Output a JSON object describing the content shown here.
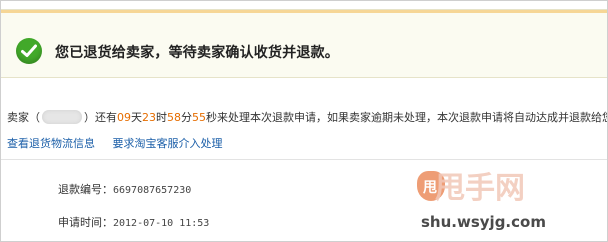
{
  "status": {
    "message": "您已退货给卖家，等待卖家确认收货并退款。"
  },
  "notice": {
    "prefix": "卖家（",
    "after_name": "）还有",
    "days": "09",
    "days_unit": "天",
    "hours": "23",
    "hours_unit": "时",
    "minutes": "58",
    "minutes_unit": "分",
    "seconds": "55",
    "suffix": "秒来处理本次退款申请，如果卖家逾期未处理，本次退款申请将自动达成并退款给您。"
  },
  "links": {
    "logistics": "查看退货物流信息",
    "service": "要求淘宝客服介入处理"
  },
  "refund": {
    "number_label": "退款编号：",
    "number_value": "6697087657230",
    "time_label": "申请时间：",
    "time_value": "2012-07-10 11:53"
  },
  "watermark": {
    "bag_char": "甩",
    "logo": "甩手网",
    "site": "shu.wsyjg.com"
  },
  "colors": {
    "accent_orange": "#e66d00",
    "success_green": "#42a92a",
    "link_blue": "#1a5ea8"
  }
}
